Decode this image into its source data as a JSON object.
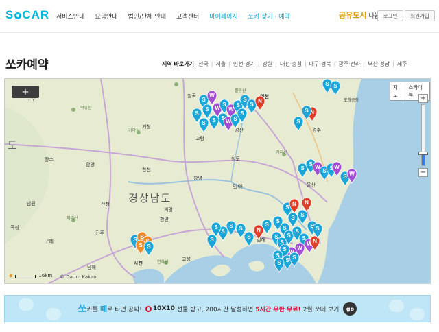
{
  "header": {
    "logo_left": "S",
    "logo_right": "CAR",
    "nav": [
      {
        "label": "서비스안내",
        "highlight": false
      },
      {
        "label": "요금안내",
        "highlight": false
      },
      {
        "label": "법인/단체 안내",
        "highlight": false
      },
      {
        "label": "고객센터",
        "highlight": false
      },
      {
        "label": "마이페이지",
        "highlight": true
      },
      {
        "label": "쏘카 찾기 · 예약",
        "highlight": true
      }
    ],
    "brand_mark": "공유도시",
    "brand_sub": "나눔카",
    "login": "로그인",
    "signup": "회원가입"
  },
  "page": {
    "title": "쏘카예약",
    "region_lead": "지역 바로가기",
    "regions": [
      "전국",
      "서울",
      "인천·경기",
      "강원",
      "대전·충청",
      "대구·경북",
      "광주·전라",
      "부산·경남",
      "제주"
    ]
  },
  "map": {
    "zoom_in": "+",
    "type_map": "지도",
    "type_sky": "스카이뷰",
    "zoom_plus": "+",
    "zoom_minus": "−",
    "zoom_level_fraction": 0.22,
    "scale": "16km",
    "attribution": "© Daum Kakao",
    "labels": [
      {
        "text": "영천"
      },
      {
        "text": "경산"
      },
      {
        "text": "청도"
      },
      {
        "text": "밀양"
      },
      {
        "text": "창녕"
      },
      {
        "text": "경상남도"
      },
      {
        "text": "함안"
      },
      {
        "text": "사천"
      },
      {
        "text": "남해"
      },
      {
        "text": "고성"
      },
      {
        "text": "진주"
      },
      {
        "text": "산청"
      },
      {
        "text": "함양"
      },
      {
        "text": "거창"
      },
      {
        "text": "합천"
      },
      {
        "text": "의령"
      },
      {
        "text": "김해"
      },
      {
        "text": "양산"
      },
      {
        "text": "울산"
      },
      {
        "text": "경주"
      },
      {
        "text": "포항공항"
      },
      {
        "text": "장수"
      },
      {
        "text": "남원"
      },
      {
        "text": "곡성"
      },
      {
        "text": "구례"
      },
      {
        "text": "고령"
      },
      {
        "text": "덕유산"
      },
      {
        "text": "가야산"
      },
      {
        "text": "지리산"
      },
      {
        "text": "가지산"
      },
      {
        "text": "팔공산"
      },
      {
        "text": "도"
      },
      {
        "text": "칠곡"
      },
      {
        "text": "무주"
      },
      {
        "text": "연화산"
      }
    ],
    "colors": {
      "pin_blue": "#1aa6d9",
      "pin_purple": "#a24fd3",
      "pin_red": "#e0402a",
      "pin_orange": "#f08a24"
    }
  },
  "banner": {
    "brand": "쏘",
    "t1": "카를",
    "brand2": "떼",
    "t2": "로 타면 공짜!",
    "bold": "10X10",
    "t3": "선물 받고, 200시간 달성하면",
    "red": "5시간 무한 무료!",
    "t4": "2월 쏘떼 보기",
    "go": "go"
  }
}
